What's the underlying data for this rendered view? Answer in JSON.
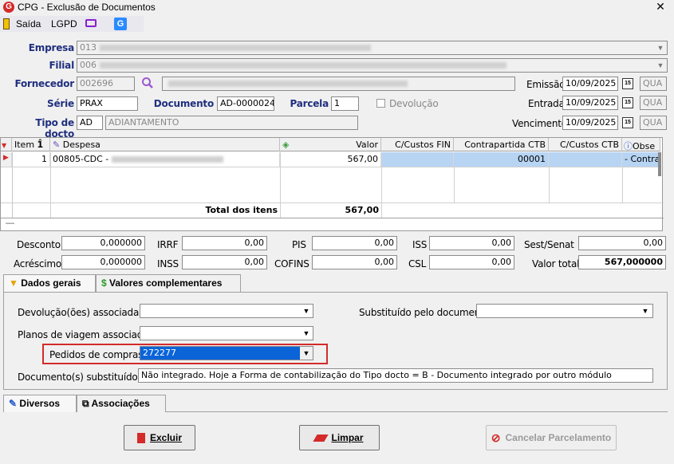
{
  "window": {
    "title": "CPG - Exclusão de Documentos",
    "close": "✕"
  },
  "toolbar": {
    "saida": "Saída",
    "lgpd": "LGPD"
  },
  "form": {
    "empresa_label": "Empresa",
    "empresa_value": "013",
    "filial_label": "Filial",
    "filial_value": "006",
    "fornecedor_label": "Fornecedor",
    "fornecedor_value": "002696",
    "serie_label": "Série",
    "serie_value": "PRAX",
    "documento_label": "Documento",
    "documento_value": "AD-0000024",
    "parcela_label": "Parcela",
    "parcela_value": "1",
    "devolucao_label": "Devolução",
    "tipo_label": "Tipo de docto",
    "tipo_value": "AD",
    "tipo_desc": "ADIANTAMENTO",
    "emissao_label": "Emissão",
    "emissao_value": "10/09/2025",
    "emissao_day": "QUA",
    "entrada_label": "Entrada",
    "entrada_value": "10/09/2025",
    "entrada_day": "QUA",
    "vencimento_label": "Vencimento",
    "vencimento_value": "10/09/2025",
    "vencimento_day": "QUA",
    "cal_icon": "15"
  },
  "grid": {
    "headers": {
      "item": "Item",
      "despesa": "Despesa",
      "valor": "Valor",
      "cc_fin": "C/Custos FIN",
      "contrapartida": "Contrapartida CTB",
      "cc_ctb": "C/Custos CTB",
      "obs": "Obse"
    },
    "row": {
      "item": "1",
      "despesa": "00805-CDC -",
      "valor": "567,00",
      "contrapartida": "00001",
      "obs": "- Contrap"
    },
    "total_label": "Total dos itens",
    "total_value": "567,00",
    "minus": "—"
  },
  "totals": {
    "desconto_label": "Desconto",
    "desconto": "0,000000",
    "acrescimo_label": "Acréscimo",
    "acrescimo": "0,000000",
    "irrf_label": "IRRF",
    "irrf": "0,00",
    "inss_label": "INSS",
    "inss": "0,00",
    "pis_label": "PIS",
    "pis": "0,00",
    "cofins_label": "COFINS",
    "cofins": "0,00",
    "iss_label": "ISS",
    "iss": "0,00",
    "csl_label": "CSL",
    "csl": "0,00",
    "sest_label": "Sest/Senat",
    "sest": "0,00",
    "valortotal_label": "Valor total",
    "valortotal": "567,000000"
  },
  "tabs": {
    "dados_gerais": "Dados gerais",
    "valores_complementares": "Valores complementares"
  },
  "dados": {
    "devolucoes_label": "Devolução(ões) associada(s)",
    "substituido_label": "Substituído pelo documento",
    "planos_label": "Planos de viagem associado",
    "pedidos_label": "Pedidos de compras",
    "pedidos_value": "272277",
    "docsubst_label": "Documento(s) substituído(s)",
    "docsubst_value": "Não integrado. Hoje a Forma de contabilização do Tipo docto = B - Documento integrado por outro módulo"
  },
  "bottom_tabs": {
    "diversos": "Diversos",
    "associacoes": "Associações"
  },
  "buttons": {
    "excluir": "Excluir",
    "limpar": "Limpar",
    "cancelar": "Cancelar Parcelamento"
  },
  "colors": {
    "accent_red": "#d42a2a",
    "label_blue": "#1f2f7f",
    "selection_blue": "#0a64d8",
    "selected_cell": "#b7d4f3"
  }
}
